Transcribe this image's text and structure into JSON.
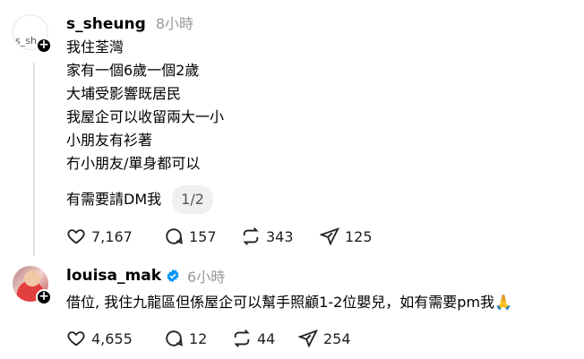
{
  "post1": {
    "avatar_alt": "s_sh",
    "username": "s_sheung",
    "time": "8小時",
    "lines": [
      "我住荃灣",
      "家有一個6歲一個2歲",
      "大埔受影響既居民",
      "我屋企可以收留兩大一小",
      "小朋友有衫著",
      "冇小朋友/單身都可以"
    ],
    "last_line": "有需要請DM我",
    "page": "1/2",
    "likes": "7,167",
    "comments": "157",
    "reposts": "343",
    "shares": "125"
  },
  "post2": {
    "username": "louisa_mak",
    "time": "6小時",
    "text": "借位, 我住九龍區但係屋企可以幫手照顧1-2位嬰兒，如有需要pm我",
    "emoji": "🙏",
    "likes": "4,655",
    "comments": "12",
    "reposts": "44",
    "shares": "254"
  },
  "colors": {
    "verified": "#0095f6",
    "muted": "#999999"
  },
  "icons": [
    "heart-icon",
    "comment-icon",
    "repost-icon",
    "share-icon",
    "verified-badge-icon",
    "plus-icon"
  ]
}
